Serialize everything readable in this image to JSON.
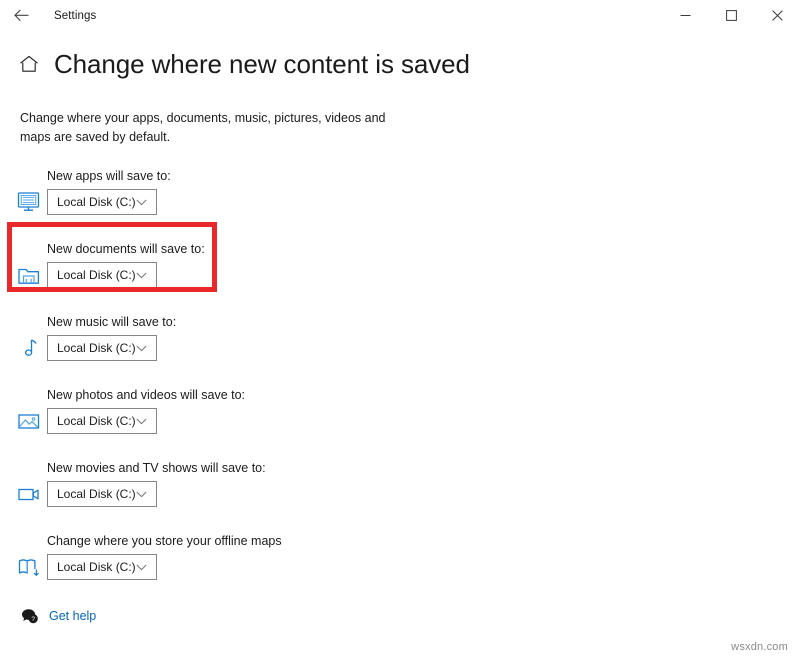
{
  "window": {
    "app_title": "Settings",
    "back_icon": "back-arrow-icon",
    "minimize_label": "Minimize",
    "maximize_label": "Maximize",
    "close_label": "Close"
  },
  "header": {
    "home_icon": "home-icon",
    "title": "Change where new content is saved"
  },
  "description": "Change where your apps, documents, music, pictures, videos and maps are saved by default.",
  "settings": [
    {
      "label": "New apps will save to:",
      "icon": "monitor-apps-icon",
      "value": "Local Disk (C:)",
      "name": "apps"
    },
    {
      "label": "New documents will save to:",
      "icon": "documents-folder-icon",
      "value": "Local Disk (C:)",
      "name": "documents"
    },
    {
      "label": "New music will save to:",
      "icon": "music-note-icon",
      "value": "Local Disk (C:)",
      "name": "music"
    },
    {
      "label": "New photos and videos will save to:",
      "icon": "picture-icon",
      "value": "Local Disk (C:)",
      "name": "photos"
    },
    {
      "label": "New movies and TV shows will save to:",
      "icon": "video-camera-icon",
      "value": "Local Disk (C:)",
      "name": "movies"
    },
    {
      "label": "Change where you store your offline maps",
      "icon": "map-download-icon",
      "value": "Local Disk (C:)",
      "name": "maps"
    }
  ],
  "highlight": {
    "color": "#e8282b",
    "target": "documents"
  },
  "footer": {
    "help_icon": "help-chat-icon",
    "help_label": "Get help"
  },
  "watermark": "wsxdn.com"
}
